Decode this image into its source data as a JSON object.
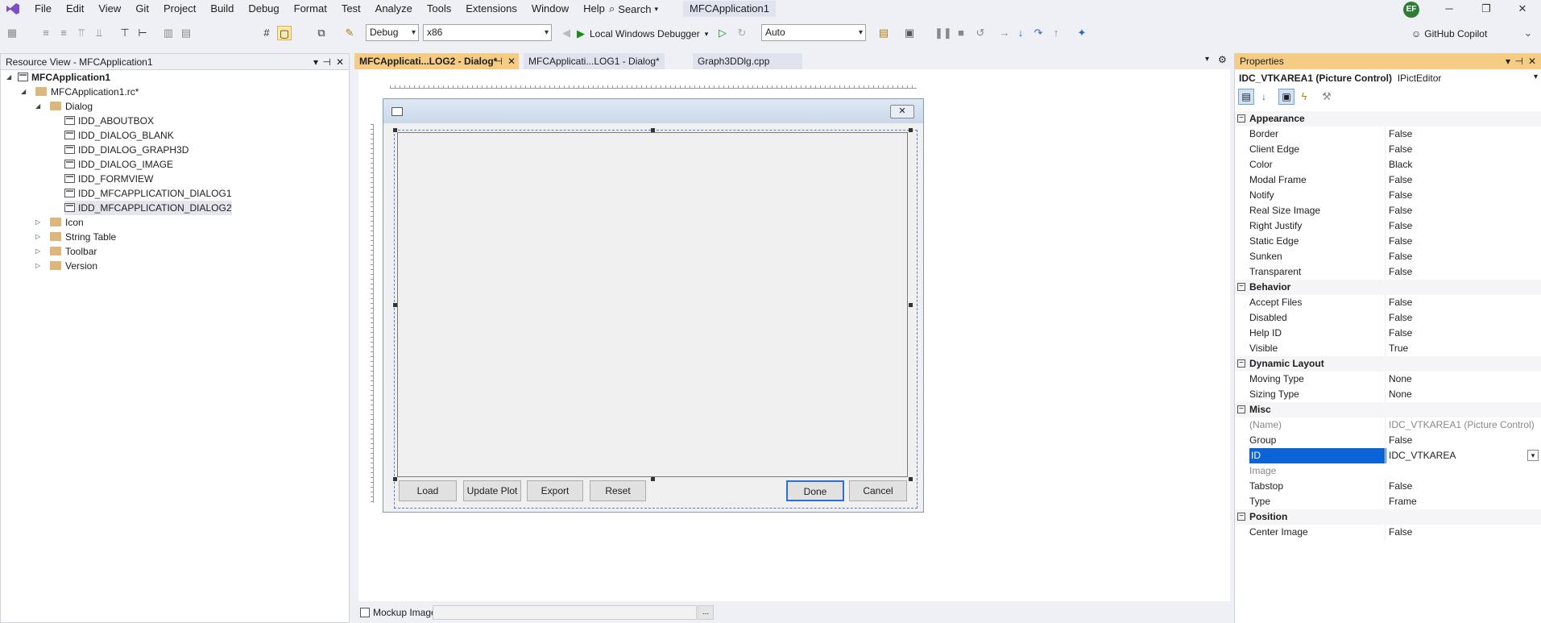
{
  "menu": [
    "File",
    "Edit",
    "View",
    "Git",
    "Project",
    "Build",
    "Debug",
    "Format",
    "Test",
    "Analyze",
    "Tools",
    "Extensions",
    "Window",
    "Help"
  ],
  "search_label": "Search",
  "project_tab": "MFCApplication1",
  "avatar": "EF",
  "toolbar": {
    "config": "Debug",
    "platform": "x86",
    "debugger": "Local Windows Debugger",
    "auto": "Auto",
    "copilot": "GitHub Copilot"
  },
  "resource_view": {
    "title": "Resource View - MFCApplication1",
    "root": "MFCApplication1",
    "rc": "MFCApplication1.rc*",
    "dialog_folder": "Dialog",
    "dialogs": [
      "IDD_ABOUTBOX",
      "IDD_DIALOG_BLANK",
      "IDD_DIALOG_GRAPH3D",
      "IDD_DIALOG_IMAGE",
      "IDD_FORMVIEW",
      "IDD_MFCAPPLICATION_DIALOG1",
      "IDD_MFCAPPLICATION_DIALOG2"
    ],
    "folders": [
      "Icon",
      "String Table",
      "Toolbar",
      "Version"
    ]
  },
  "tabs": [
    "MFCApplicati...LOG2 - Dialog*",
    "MFCApplicati...LOG1 - Dialog*",
    "Graph3DDlg.cpp"
  ],
  "dialog": {
    "buttons": [
      "Load",
      "Update Plot",
      "Export",
      "Reset",
      "Done",
      "Cancel"
    ]
  },
  "mockup_label": "Mockup Image:",
  "properties": {
    "title": "Properties",
    "object": "IDC_VTKAREA1 (Picture Control)",
    "object_type": "IPictEditor",
    "sections": [
      {
        "name": "Appearance",
        "rows": [
          [
            "Border",
            "False"
          ],
          [
            "Client Edge",
            "False"
          ],
          [
            "Color",
            "Black"
          ],
          [
            "Modal Frame",
            "False"
          ],
          [
            "Notify",
            "False"
          ],
          [
            "Real Size Image",
            "False"
          ],
          [
            "Right Justify",
            "False"
          ],
          [
            "Static Edge",
            "False"
          ],
          [
            "Sunken",
            "False"
          ],
          [
            "Transparent",
            "False"
          ]
        ]
      },
      {
        "name": "Behavior",
        "rows": [
          [
            "Accept Files",
            "False"
          ],
          [
            "Disabled",
            "False"
          ],
          [
            "Help ID",
            "False"
          ],
          [
            "Visible",
            "True"
          ]
        ]
      },
      {
        "name": "Dynamic Layout",
        "rows": [
          [
            "Moving Type",
            "None"
          ],
          [
            "Sizing Type",
            "None"
          ]
        ]
      },
      {
        "name": "Misc",
        "rows": [
          [
            "(Name)",
            "IDC_VTKAREA1 (Picture Control)"
          ],
          [
            "Group",
            "False"
          ],
          [
            "ID",
            "IDC_VTKAREA"
          ],
          [
            "Image",
            ""
          ],
          [
            "Tabstop",
            "False"
          ],
          [
            "Type",
            "Frame"
          ]
        ]
      },
      {
        "name": "Position",
        "rows": [
          [
            "Center Image",
            "False"
          ]
        ]
      }
    ]
  }
}
